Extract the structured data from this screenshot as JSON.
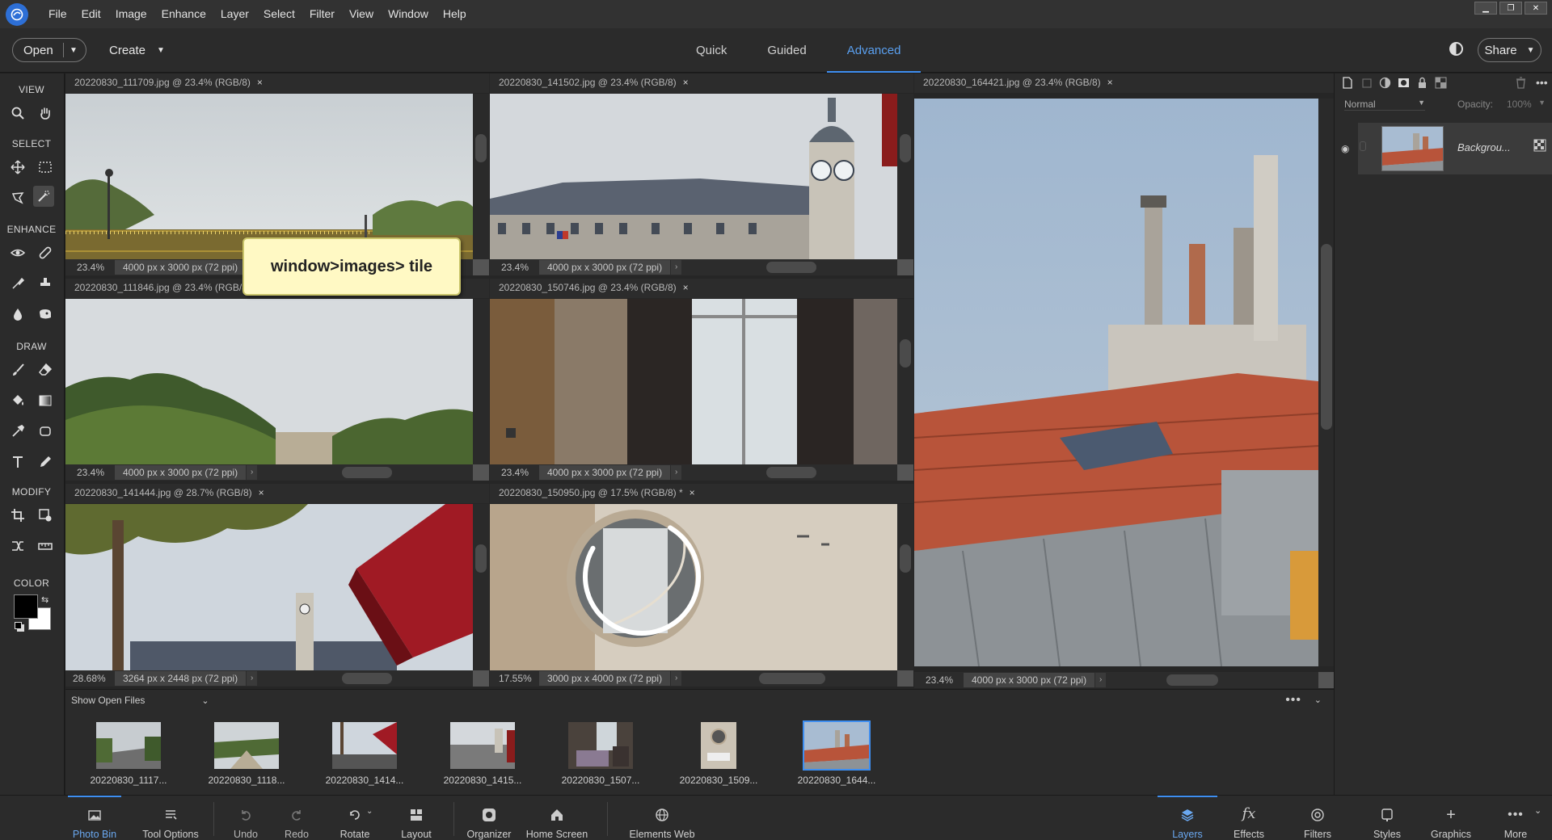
{
  "menubar": {
    "items": [
      "File",
      "Edit",
      "Image",
      "Enhance",
      "Layer",
      "Select",
      "Filter",
      "View",
      "Window",
      "Help"
    ]
  },
  "modebar": {
    "open_label": "Open",
    "create_label": "Create",
    "tabs": [
      "Quick",
      "Guided",
      "Advanced"
    ],
    "active_tab": "Advanced",
    "share_label": "Share"
  },
  "toolbox": {
    "sections": [
      "VIEW",
      "SELECT",
      "ENHANCE",
      "DRAW",
      "MODIFY",
      "COLOR"
    ]
  },
  "documents": [
    {
      "title": "20220830_111709.jpg @ 23.4% (RGB/8)",
      "zoom": "23.4%",
      "dims": "4000 px x 3000 px (72 ppi)"
    },
    {
      "title": "20220830_141502.jpg @ 23.4% (RGB/8)",
      "zoom": "23.4%",
      "dims": "4000 px x 3000 px (72 ppi)"
    },
    {
      "title": "20220830_164421.jpg @ 23.4% (RGB/8)",
      "zoom": "23.4%",
      "dims": "4000 px x 3000 px (72 ppi)"
    },
    {
      "title": "20220830_111846.jpg @ 23.4% (RGB/8)",
      "zoom": "23.4%",
      "dims": "4000 px x 3000 px (72 ppi)"
    },
    {
      "title": "20220830_150746.jpg @ 23.4% (RGB/8)",
      "zoom": "23.4%",
      "dims": "4000 px x 3000 px (72 ppi)"
    },
    {
      "title": "20220830_141444.jpg @ 28.7% (RGB/8)",
      "zoom": "28.68%",
      "dims": "3264 px x 2448 px (72 ppi)"
    },
    {
      "title": "20220830_150950.jpg @ 17.5% (RGB/8) *",
      "zoom": "17.55%",
      "dims": "3000 px x 4000 px (72 ppi)"
    }
  ],
  "close_glyph": "×",
  "callout": "window>images> tile",
  "photobin": {
    "dropdown": "Show Open Files",
    "thumbs": [
      "20220830_1117...",
      "20220830_1118...",
      "20220830_1414...",
      "20220830_1415...",
      "20220830_1507...",
      "20220830_1509...",
      "20220830_1644..."
    ]
  },
  "layers": {
    "blend_mode": "Normal",
    "opacity_label": "Opacity:",
    "opacity_value": "100%",
    "layer_name": "Backgrou..."
  },
  "taskbar": {
    "left": [
      "Photo Bin",
      "Tool Options",
      "Undo",
      "Redo",
      "Rotate",
      "Layout",
      "Organizer",
      "Home Screen",
      "Elements Web"
    ],
    "right": [
      "Layers",
      "Effects",
      "Filters",
      "Styles",
      "Graphics",
      "More"
    ],
    "active_left": "Photo Bin",
    "active_right": "Layers"
  },
  "colors": {
    "accent": "#3e8ef0",
    "foreground_swatch": "#000000",
    "background_swatch": "#ffffff",
    "callout_bg": "#fff9c4"
  }
}
